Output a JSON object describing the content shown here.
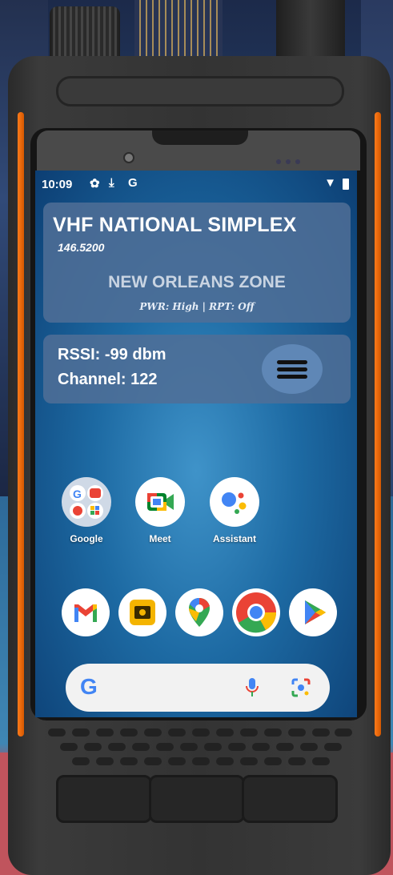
{
  "status_bar": {
    "time": "10:09",
    "icons": [
      "settings-icon",
      "download-icon",
      "google-g-icon",
      "wifi-icon",
      "battery-icon"
    ]
  },
  "channel_card": {
    "channel_name": "VHF NATIONAL SIMPLEX",
    "frequency": "146.5200",
    "zone": "NEW ORLEANS ZONE",
    "power_repeater": "PWR: High | RPT: Off"
  },
  "signal_card": {
    "rssi": "RSSI: -99 dbm",
    "channel": "Channel: 122",
    "menu_icon": "hamburger-menu-icon"
  },
  "home_apps": [
    {
      "label": "Google",
      "icon": "google-folder-icon"
    },
    {
      "label": "Meet",
      "icon": "meet-icon"
    },
    {
      "label": "Assistant",
      "icon": "assistant-icon"
    }
  ],
  "dock_apps": [
    {
      "icon": "gmail-icon"
    },
    {
      "icon": "radio-app-icon"
    },
    {
      "icon": "maps-icon"
    },
    {
      "icon": "chrome-icon"
    },
    {
      "icon": "play-store-icon"
    }
  ],
  "search_bar": {
    "logo": "G",
    "icons": [
      "mic-icon",
      "lens-icon"
    ]
  },
  "colors": {
    "card_bg": "#506e96",
    "device_orange": "#ff7a1a",
    "google_blue": "#4285f4",
    "google_red": "#ea4335",
    "google_yellow": "#fbbc05",
    "google_green": "#34a853"
  }
}
